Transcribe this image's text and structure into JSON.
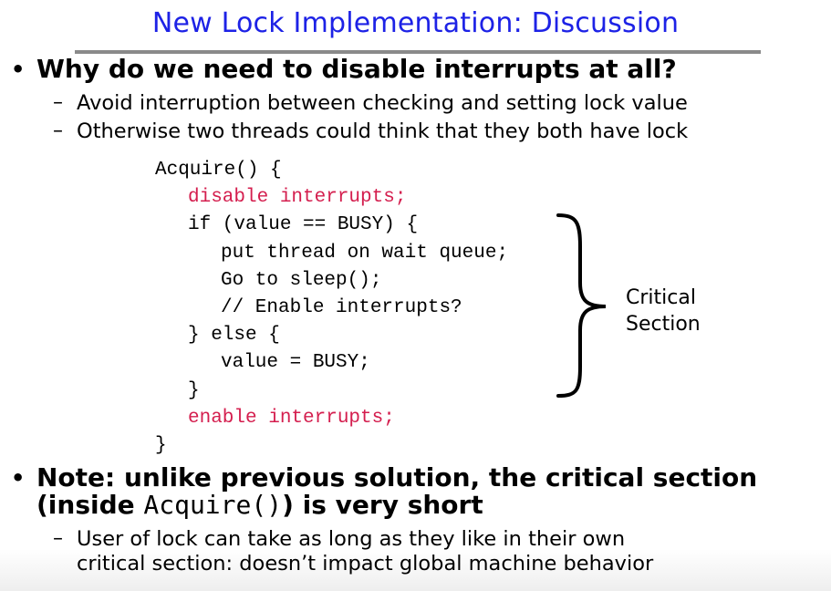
{
  "slide": {
    "title": "New Lock Implementation: Discussion",
    "bullet1": {
      "marker": "•",
      "text": "Why do we need to disable interrupts at all?",
      "subs": [
        {
          "marker": "–",
          "text": "Avoid interruption between checking and setting lock value"
        },
        {
          "marker": "–",
          "text": "Otherwise two threads could think that they both have lock"
        }
      ]
    },
    "code": [
      {
        "text": "Acquire() {",
        "indent": 0,
        "color": "black"
      },
      {
        "text": "disable interrupts;",
        "indent": 1,
        "color": "red"
      },
      {
        "text": "if (value == BUSY) {",
        "indent": 1,
        "color": "black"
      },
      {
        "text": "put thread on wait queue;",
        "indent": 2,
        "color": "black"
      },
      {
        "text": "Go to sleep();",
        "indent": 2,
        "color": "black"
      },
      {
        "text": "// Enable interrupts?",
        "indent": 2,
        "color": "black"
      },
      {
        "text": "} else {",
        "indent": 1,
        "color": "black"
      },
      {
        "text": "value = BUSY;",
        "indent": 2,
        "color": "black"
      },
      {
        "text": "}",
        "indent": 1,
        "color": "black"
      },
      {
        "text": "enable interrupts;",
        "indent": 1,
        "color": "red"
      },
      {
        "text": "}",
        "indent": 0,
        "color": "black"
      }
    ],
    "critical_label": {
      "line1": "Critical",
      "line2": "Section"
    },
    "bullet2": {
      "marker": "•",
      "line1": "Note: unlike previous solution, the critical section",
      "line2_pre": "(inside ",
      "line2_code": "Acquire()",
      "line2_post": ") is very short",
      "subs": [
        {
          "marker": "–",
          "line1": "User of lock can take as long as they like in their own",
          "line2": "critical section: doesn’t impact global machine behavior"
        }
      ]
    },
    "colors": {
      "title": "#1d22e6",
      "code_red": "#d41e4e",
      "rule": "#8a8a8a"
    }
  }
}
